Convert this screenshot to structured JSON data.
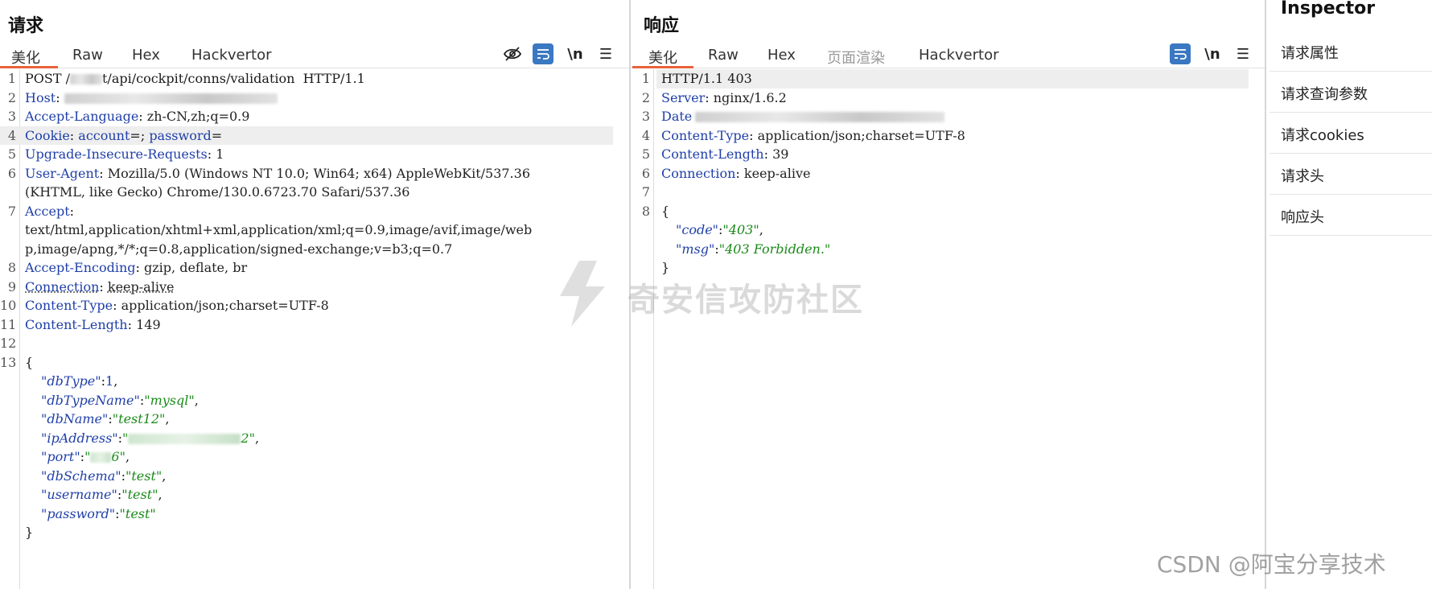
{
  "request": {
    "title": "请求",
    "tabs": [
      "美化",
      "Raw",
      "Hex",
      "Hackvertor"
    ],
    "active_tab": "美化",
    "lines": [
      {
        "n": "1",
        "text": "POST /",
        "after": "t/api/cockpit/conns/validation  HTTP/1.1"
      },
      {
        "n": "2",
        "key": "Host",
        "value": ""
      },
      {
        "n": "3",
        "key": "Accept-Language",
        "value": "zh-CN,zh;q=0.9"
      },
      {
        "n": "4",
        "key": "Cookie",
        "c1": "account",
        "c2": "password"
      },
      {
        "n": "5",
        "key": "Upgrade-Insecure-Requests",
        "value": "1"
      },
      {
        "n": "6",
        "key": "User-Agent",
        "value": "Mozilla/5.0 (Windows NT 10.0; Win64; x64) AppleWebKit/537.36",
        "cont": "(KHTML, like Gecko) Chrome/130.0.6723.70 Safari/537.36"
      },
      {
        "n": "7",
        "key": "Accept",
        "cont1": "text/html,application/xhtml+xml,application/xml;q=0.9,image/avif,image/web",
        "cont2": "p,image/apng,*/*;q=0.8,application/signed-exchange;v=b3;q=0.7"
      },
      {
        "n": "8",
        "key": "Accept-Encoding",
        "value": "gzip, deflate, br"
      },
      {
        "n": "9",
        "key": "Connection",
        "value": "keep-alive"
      },
      {
        "n": "10",
        "key": "Content-Type",
        "value": "application/json;charset=UTF-8"
      },
      {
        "n": "11",
        "key": "Content-Length",
        "value": "149"
      },
      {
        "n": "12"
      },
      {
        "n": "13"
      }
    ],
    "body": {
      "open": "{",
      "dbType_k": "\"dbType\"",
      "dbType_v": "1",
      "dbTypeName_k": "\"dbTypeName\"",
      "dbTypeName_v": "\"mysql\"",
      "dbName_k": "\"dbName\"",
      "dbName_v": "\"test12\"",
      "ipAddress_k": "\"ipAddress\"",
      "ipAddress_v_start": "\"",
      "ipAddress_v_end": "2\"",
      "port_k": "\"port\"",
      "port_v_start": "\"",
      "port_v_end": "6\"",
      "dbSchema_k": "\"dbSchema\"",
      "dbSchema_v": "\"test\"",
      "username_k": "\"username\"",
      "username_v": "\"test\"",
      "password_k": "\"password\"",
      "password_v": "\"test\"",
      "close": "}"
    },
    "tools": {
      "hide_icon": "eye-off-icon",
      "wrap_icon": "wrap-icon",
      "newline_label": "\\n",
      "menu_icon": "menu-icon"
    }
  },
  "response": {
    "title": "响应",
    "tabs": [
      "美化",
      "Raw",
      "Hex",
      "页面渲染",
      "Hackvertor"
    ],
    "active_tab": "美化",
    "l1": "HTTP/1.1 403",
    "server_k": "Server",
    "server_v": "nginx/1.6.2",
    "date_k": "Date",
    "ct_k": "Content-Type",
    "ct_v": "application/json;charset=UTF-8",
    "cl_k": "Content-Length",
    "cl_v": "39",
    "conn_k": "Connection",
    "conn_v": "keep-alive",
    "open": "{",
    "code_k": "\"code\"",
    "code_v": "\"403\"",
    "msg_k": "\"msg\"",
    "msg_v": "\"403 Forbidden.\"",
    "close": "}",
    "tools": {
      "newline_label": "\\n"
    }
  },
  "inspector": {
    "title": "Inspector",
    "items": [
      "请求属性",
      "请求查询参数",
      "请求cookies",
      "请求头",
      "响应头"
    ]
  },
  "watermark": "奇安信攻防社区",
  "csdn": "CSDN @阿宝分享技术",
  "colors": {
    "accent": "#e8623a",
    "key": "#1f3fa8",
    "string": "#1a8a1a",
    "toolbar_active": "#3a78c2"
  }
}
